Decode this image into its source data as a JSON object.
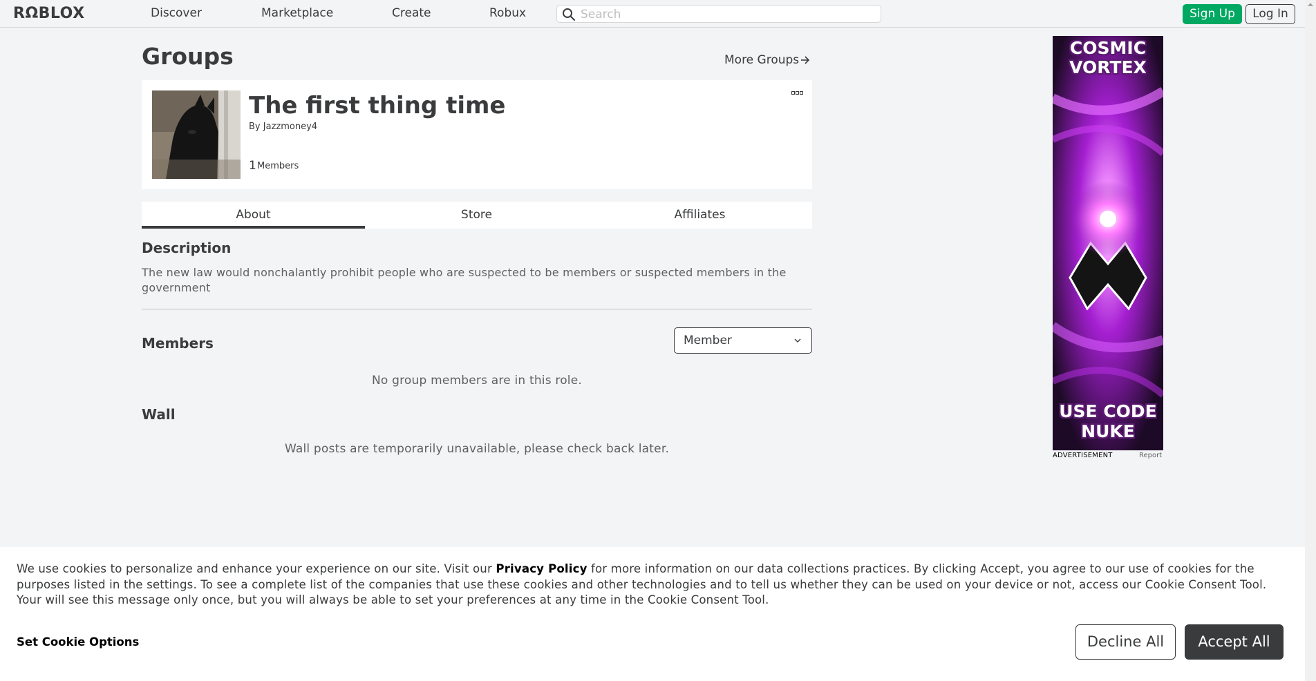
{
  "nav": {
    "logo": "RΩBLOX",
    "links": [
      "Discover",
      "Marketplace",
      "Create",
      "Robux"
    ],
    "search_placeholder": "Search",
    "signup_label": "Sign Up",
    "login_label": "Log In"
  },
  "page": {
    "title": "Groups",
    "more_groups": "More Groups"
  },
  "group": {
    "name": "The first thing time",
    "by_prefix": "By",
    "owner": "Jazzmoney4",
    "member_count": "1",
    "member_label": "Members"
  },
  "tabs": [
    {
      "label": "About",
      "active": true
    },
    {
      "label": "Store",
      "active": false
    },
    {
      "label": "Affiliates",
      "active": false
    }
  ],
  "about": {
    "description_title": "Description",
    "description": "The new law would nonchalantly prohibit people who are suspected to be members or suspected members in the government",
    "members_title": "Members",
    "role_selected": "Member",
    "members_empty": "No group members are in this role.",
    "wall_title": "Wall",
    "wall_empty": "Wall posts are temporarily unavailable, please check back later."
  },
  "ad": {
    "headline_1": "COSMIC",
    "headline_2": "VORTEX",
    "footer_1": "USE CODE",
    "footer_2": "NUKE",
    "label": "ADVERTISEMENT",
    "report": "Report"
  },
  "cookie": {
    "text_1": "We use cookies to personalize and enhance your experience on our site. Visit our ",
    "privacy_link": "Privacy Policy",
    "text_2": " for more information on our data collections practices. By clicking Accept, you agree to our use of cookies for the purposes listed in the settings. To see a complete list of the companies that use these cookies and other technologies and to tell us whether they can be used on your device or not, access our Cookie Consent Tool. Your will see this message only once, but you will always be able to set your preferences at any time in the Cookie Consent Tool.",
    "options_label": "Set Cookie Options",
    "decline_label": "Decline All",
    "accept_label": "Accept All"
  },
  "colors": {
    "signup_green": "#00a862",
    "text_dark": "#393b3d",
    "background": "#f2f4f5",
    "ad_magenta": "#d63fff"
  },
  "icons": [
    "search-icon",
    "arrow-right-icon",
    "more-horizontal-icon",
    "chevron-down-icon"
  ]
}
